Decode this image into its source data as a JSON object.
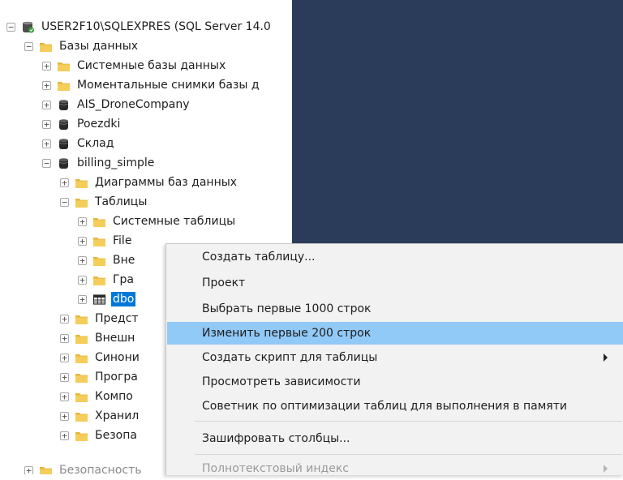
{
  "tree": {
    "server": "USER2F10\\SQLEXPRES (SQL Server 14.0",
    "databases": "Базы данных",
    "system_dbs": "Системные базы данных",
    "snapshots": "Моментальные снимки базы д",
    "db1": "AIS_DroneCompany",
    "db2": "Poezdki",
    "db3": "Склад",
    "db4": "billing_simple",
    "diagrams": "Диаграммы баз данных",
    "tables": "Таблицы",
    "system_tables": "Системные таблицы",
    "file_tables": "File",
    "external_tables": "Вне",
    "graph_tables": "Гра",
    "dbo_table": "dbo",
    "views": "Предст",
    "external": "Внешн",
    "synonyms": "Синони",
    "programmability": "Програ",
    "components": "Компо",
    "storage": "Хранил",
    "security_db": "Безопа",
    "security_server": "Безопасность"
  },
  "context_menu": {
    "items": [
      {
        "label": "Создать таблицу..."
      },
      {
        "label": "Проект"
      },
      {
        "label": "Выбрать первые 1000 строк"
      },
      {
        "label": "Изменить первые 200 строк"
      },
      {
        "label": "Создать скрипт для таблицы"
      },
      {
        "label": "Просмотреть зависимости"
      },
      {
        "label": "Советник по оптимизации таблиц для выполнения в памяти"
      },
      {
        "label": "Зашифровать столбцы..."
      },
      {
        "label": "Полнотекстовый индекс"
      }
    ]
  },
  "colors": {
    "selection": "#0078d7",
    "menu_highlight": "#91c9f7",
    "folder": "#f0c54d",
    "dark_background": "#2b3c5a"
  }
}
